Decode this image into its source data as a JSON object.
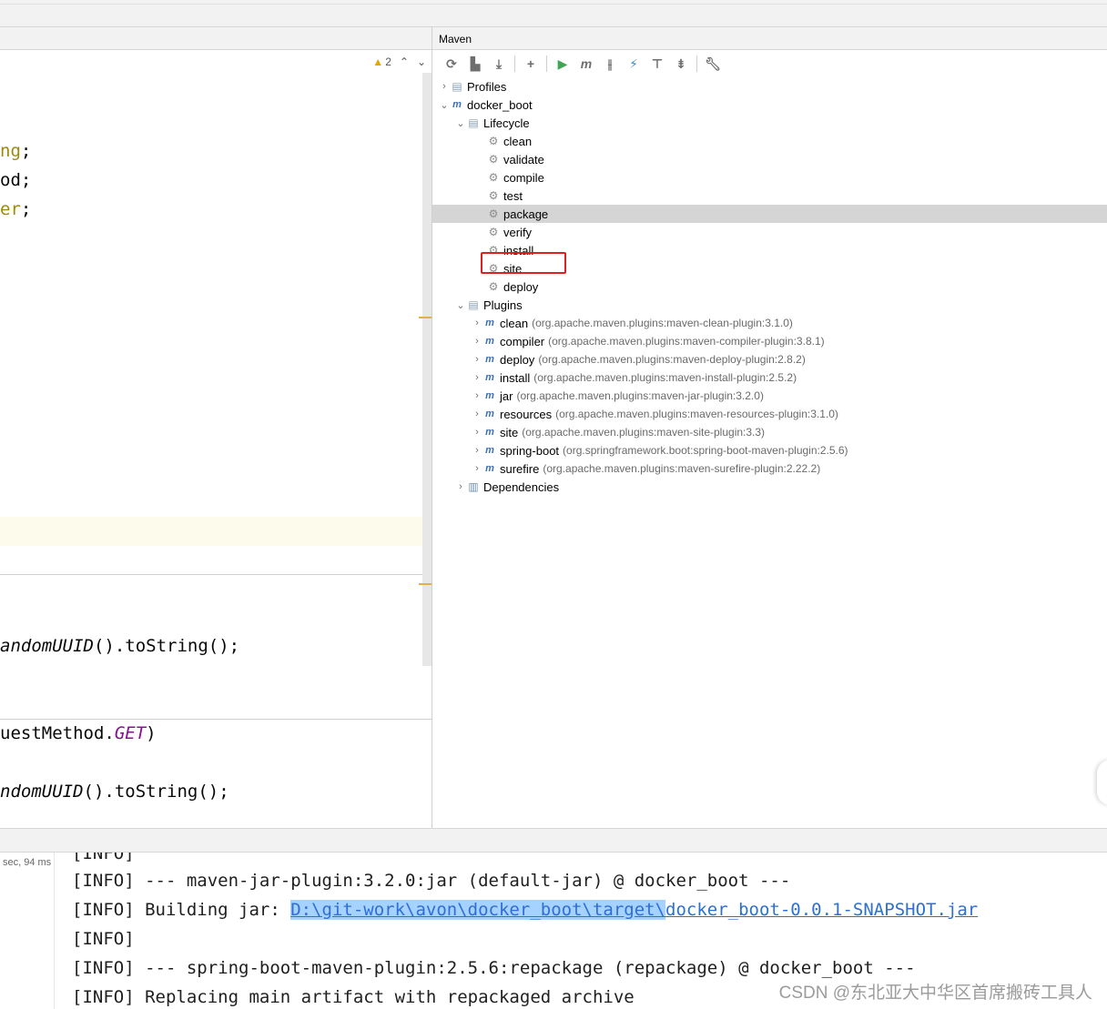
{
  "editor": {
    "inspection": {
      "warning_count": "2"
    },
    "code_lines": [
      {
        "pre": "",
        "colored": "ng",
        "post": ";"
      },
      {
        "pre": "od;",
        "colored": "",
        "post": ""
      },
      {
        "pre": "",
        "colored": "er",
        "post": ";"
      }
    ],
    "line_uuid_1": {
      "italic": "andomUUID",
      "rest": "().toString();"
    },
    "line_get": {
      "pre": "uestMethod.",
      "purple": "GET",
      "post": ")"
    },
    "line_uuid_2": {
      "italic": "ndomUUID",
      "rest": "().toString();"
    }
  },
  "maven": {
    "title": "Maven",
    "toolbar": [
      "reload-icon",
      "add-sources-icon",
      "download-icon",
      "plus-icon",
      "run-icon",
      "execute-goal-icon",
      "toggle-offline-icon",
      "skip-tests-icon",
      "show-deps-icon",
      "collapse-icon",
      "settings-wrench-icon"
    ],
    "profiles": "Profiles",
    "project": "docker_boot",
    "lifecycle": {
      "label": "Lifecycle",
      "goals": [
        "clean",
        "validate",
        "compile",
        "test",
        "package",
        "verify",
        "install",
        "site",
        "deploy"
      ],
      "selected": "package"
    },
    "plugins": {
      "label": "Plugins",
      "items": [
        {
          "name": "clean",
          "coord": "(org.apache.maven.plugins:maven-clean-plugin:3.1.0)"
        },
        {
          "name": "compiler",
          "coord": "(org.apache.maven.plugins:maven-compiler-plugin:3.8.1)"
        },
        {
          "name": "deploy",
          "coord": "(org.apache.maven.plugins:maven-deploy-plugin:2.8.2)"
        },
        {
          "name": "install",
          "coord": "(org.apache.maven.plugins:maven-install-plugin:2.5.2)"
        },
        {
          "name": "jar",
          "coord": "(org.apache.maven.plugins:maven-jar-plugin:3.2.0)"
        },
        {
          "name": "resources",
          "coord": "(org.apache.maven.plugins:maven-resources-plugin:3.1.0)"
        },
        {
          "name": "site",
          "coord": "(org.apache.maven.plugins:maven-site-plugin:3.3)"
        },
        {
          "name": "spring-boot",
          "coord": "(org.springframework.boot:spring-boot-maven-plugin:2.5.6)"
        },
        {
          "name": "surefire",
          "coord": "(org.apache.maven.plugins:maven-surefire-plugin:2.22.2)"
        }
      ]
    },
    "dependencies": "Dependencies"
  },
  "console": {
    "elapsed": "sec, 94 ms",
    "lines": {
      "l0": "[INFO]",
      "l1": "[INFO] --- maven-jar-plugin:3.2.0:jar (default-jar) @ docker_boot ---",
      "l2_prefix": "[INFO] Building jar: ",
      "l2_path_sel": "D:\\git-work\\avon\\docker_boot\\target\\",
      "l2_path_rest": "docker_boot-0.0.1-SNAPSHOT.jar",
      "l3": "[INFO]",
      "l4": "[INFO] --- spring-boot-maven-plugin:2.5.6:repackage (repackage) @ docker_boot ---",
      "l5": "[INFO] Replacing main artifact with repackaged archive"
    }
  },
  "watermark": "CSDN @东北亚大中华区首席搬砖工具人"
}
